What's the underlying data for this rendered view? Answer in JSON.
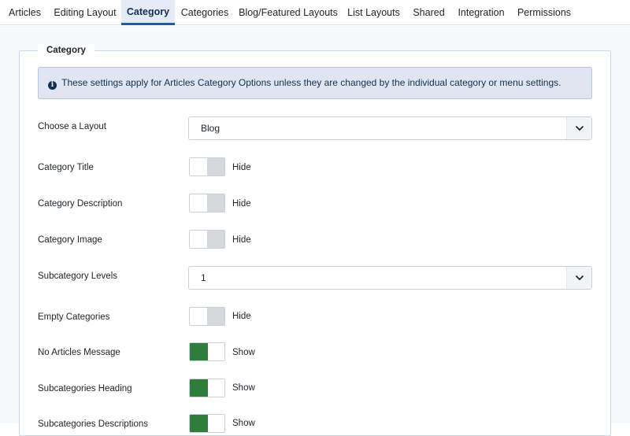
{
  "tabs": [
    {
      "label": "Articles"
    },
    {
      "label": "Editing Layout"
    },
    {
      "label": "Category",
      "active": true
    },
    {
      "label": "Categories"
    },
    {
      "label": "Blog/Featured Layouts"
    },
    {
      "label": "List Layouts"
    },
    {
      "label": "Shared"
    },
    {
      "label": "Integration"
    },
    {
      "label": "Permissions"
    }
  ],
  "fieldset": {
    "legend": "Category",
    "info_text": "These settings apply for Articles Category Options unless they are changed by the individual category or menu settings.",
    "info_icon": "info-circle-icon"
  },
  "fields": {
    "layout": {
      "label": "Choose a Layout",
      "value": "Blog"
    },
    "category_title": {
      "label": "Category Title",
      "state": "Hide"
    },
    "category_description": {
      "label": "Category Description",
      "state": "Hide"
    },
    "category_image": {
      "label": "Category Image",
      "state": "Hide"
    },
    "subcategory_levels": {
      "label": "Subcategory Levels",
      "value": "1"
    },
    "empty_categories": {
      "label": "Empty Categories",
      "state": "Hide"
    },
    "no_articles_message": {
      "label": "No Articles Message",
      "state": "Show"
    },
    "subcategories_heading": {
      "label": "Subcategories Heading",
      "state": "Show"
    },
    "subcategories_descriptions": {
      "label": "Subcategories Descriptions",
      "state": "Show"
    }
  },
  "colors": {
    "switch_on": "#2f7d3a",
    "switch_off": "#d5d8db",
    "active_tab_underline": "#1f5b9e",
    "alert_bg": "#dfe6f1"
  }
}
